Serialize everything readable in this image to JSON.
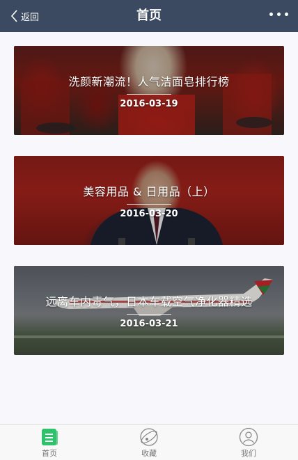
{
  "header": {
    "back_label": "返回",
    "title": "首页"
  },
  "articles": [
    {
      "title": "洗颜新潮流！人气洁面皂排行榜",
      "date": "2016-03-19"
    },
    {
      "title": "美容用品 & 日用品（上）",
      "date": "2016-03-20"
    },
    {
      "title": "远离车内毒气，日本车载空气净化器精选",
      "date": "2016-03-21"
    }
  ],
  "tabbar": {
    "tabs": [
      {
        "label": "首页",
        "icon": "home-list-icon",
        "active": true
      },
      {
        "label": "收藏",
        "icon": "planet-icon",
        "active": false
      },
      {
        "label": "我们",
        "icon": "user-icon",
        "active": false
      }
    ],
    "active_color": "#2dc26b"
  },
  "colors": {
    "header_bg": "#3b4a60",
    "page_bg": "#f8f7fb"
  }
}
